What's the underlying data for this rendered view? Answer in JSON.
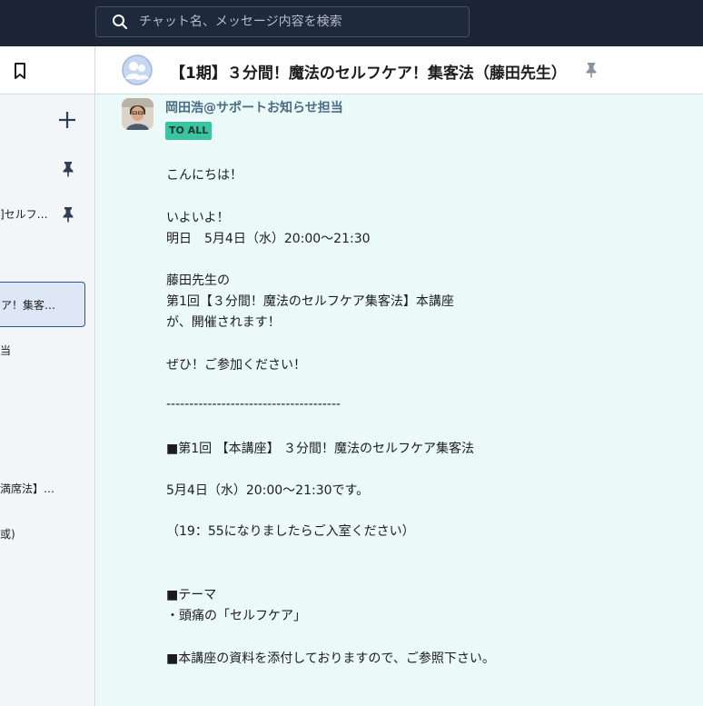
{
  "search": {
    "placeholder": "チャット名、メッセージ内容を検索"
  },
  "sidebar": {
    "items": [
      {
        "label": "]セルフ…"
      },
      {
        "label": "ア！集客…"
      },
      {
        "label": "当"
      },
      {
        "label": "満席法】…"
      },
      {
        "label": "或)"
      }
    ]
  },
  "chat": {
    "title": "【1期】３分間！魔法のセルフケア！集客法（藤田先生）"
  },
  "message": {
    "sender": "岡田浩@サポートお知らせ担当",
    "badge": "TO ALL",
    "lines": [
      "こんにちは！",
      "いよいよ！",
      "明日　5月4日（水）20:00〜21:30",
      "藤田先生の",
      "第1回【３分間！魔法のセルフケア集客法】本講座",
      "が、開催されます！",
      "ぜひ！ご参加ください！",
      "--------------------------------------",
      "■第1回 【本講座】 ３分間！魔法のセルフケア集客法",
      "5月4日（水）20:00〜21:30です。",
      "（19：55になりましたらご入室ください）",
      "■テーマ",
      "・頭痛の「セルフケア」",
      "■本講座の資料を添付しておりますので、ご参照下さい。"
    ]
  },
  "colors": {
    "topbar": "#1b2536",
    "content_bg": "#ebfaf8",
    "badge_bg": "#3cc4a2",
    "active_border": "#2f5499",
    "pin": "#2d3e57"
  },
  "icons": [
    "search-icon",
    "bookmark-icon",
    "plus-icon",
    "pin-icon",
    "group-avatar-icon"
  ]
}
